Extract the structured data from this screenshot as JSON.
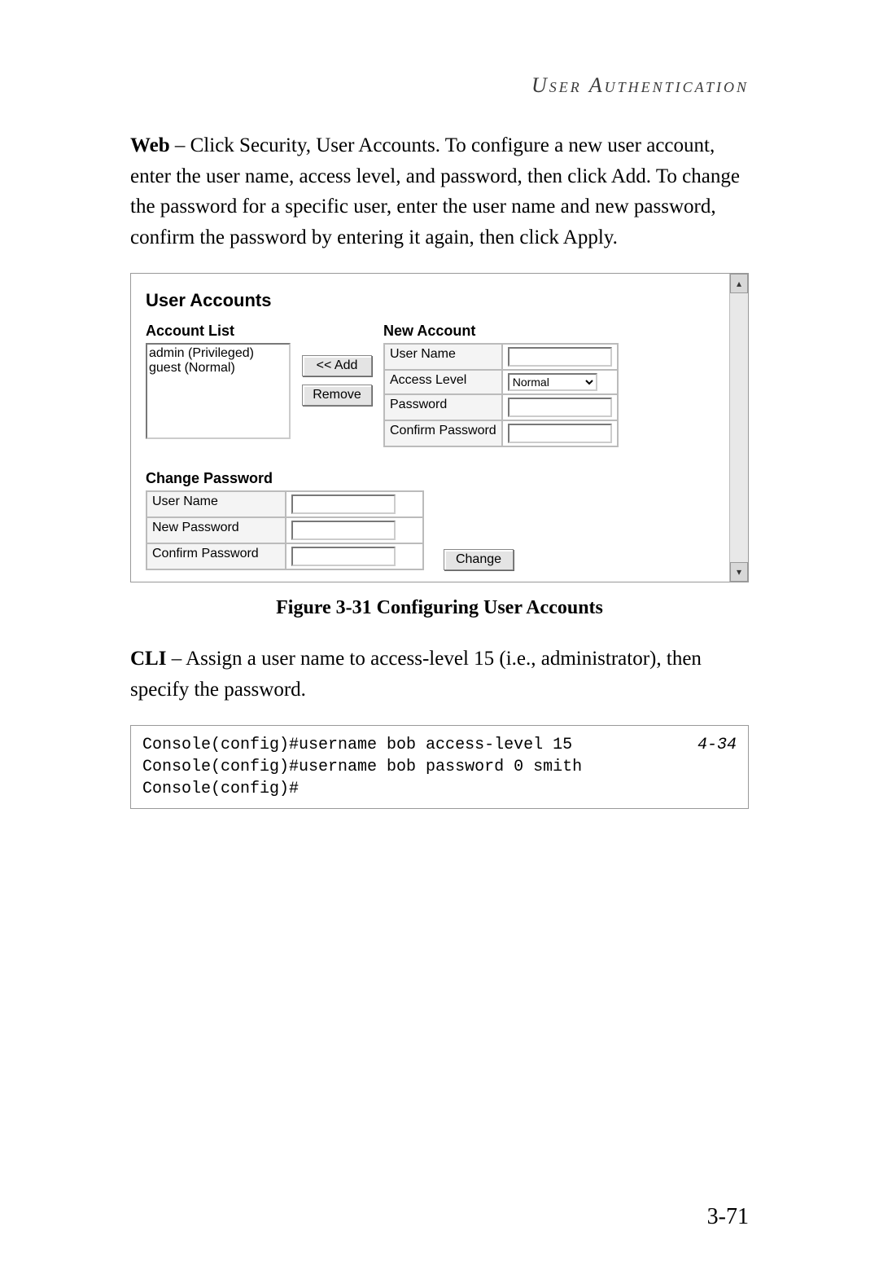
{
  "header": {
    "running_head": "User Authentication"
  },
  "para_web": {
    "lead": "Web",
    "dash": " – ",
    "rest": "Click Security, User Accounts. To configure a new user account, enter the user name, access level, and password, then click Add. To change the password for a specific user, enter the user name and new password, confirm the password by entering it again, then click Apply."
  },
  "screenshot": {
    "title": "User Accounts",
    "account_list": {
      "label": "Account List",
      "items": [
        "admin (Privileged)",
        "guest (Normal)"
      ]
    },
    "buttons": {
      "add": "<< Add",
      "remove": "Remove"
    },
    "new_account": {
      "label": "New Account",
      "fields": {
        "user_name_label": "User Name",
        "access_level_label": "Access Level",
        "access_level_value": "Normal",
        "password_label": "Password",
        "confirm_password_label": "Confirm Password"
      }
    },
    "change_password": {
      "label": "Change Password",
      "fields": {
        "user_name_label": "User Name",
        "new_password_label": "New Password",
        "confirm_password_label": "Confirm Password"
      },
      "change_btn": "Change"
    },
    "scroll": {
      "up": "▴",
      "down": "▾"
    }
  },
  "figure_caption": "Figure 3-31  Configuring User Accounts",
  "para_cli": {
    "lead": "CLI",
    "dash": " – ",
    "rest": "Assign a user name to access-level 15 (i.e., administrator), then specify the password."
  },
  "cli": {
    "lines": "Console(config)#username bob access-level 15\nConsole(config)#username bob password 0 smith\nConsole(config)#",
    "ref": "4-34"
  },
  "page_number": "3-71"
}
